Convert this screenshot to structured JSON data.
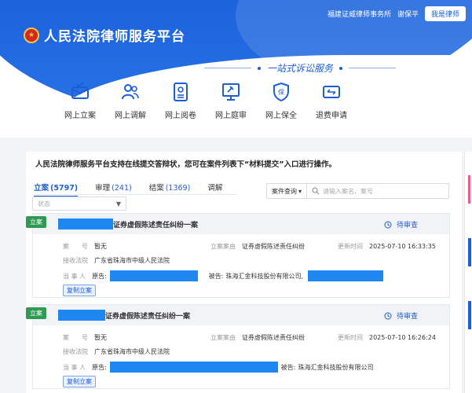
{
  "header": {
    "firm": "福建证威律师事务所",
    "user": "谢保平",
    "login_label": "我是律师",
    "site_title": "人民法院律师服务平台",
    "slogan": "一站式诉讼服务"
  },
  "services": [
    {
      "label": "网上立案",
      "icon": "mail-check-icon"
    },
    {
      "label": "网上调解",
      "icon": "users-icon"
    },
    {
      "label": "网上阅卷",
      "icon": "document-view-icon"
    },
    {
      "label": "网上庭审",
      "icon": "courtroom-icon"
    },
    {
      "label": "网上保全",
      "icon": "shield-icon"
    },
    {
      "label": "退费申请",
      "icon": "refund-icon"
    }
  ],
  "notice": "人民法院律师服务平台支持在线提交答辩状，您可在案件列表下“材料提交”入口进行操作。",
  "tabs": [
    {
      "label": "立案",
      "count": "(5797)",
      "active": true
    },
    {
      "label": "审理",
      "count": "(241)",
      "active": false
    },
    {
      "label": "结案",
      "count": "(1369)",
      "active": false
    },
    {
      "label": "调解",
      "count": "",
      "active": false
    }
  ],
  "filters": {
    "status_placeholder": "状态",
    "query_type": "案件查询",
    "search_placeholder": "请输入案名、案号"
  },
  "cases": [
    {
      "tag": "立案",
      "title_suffix": "证券虚假陈述责任纠纷一案",
      "status": "待审查",
      "case_no_label": "案　　号",
      "case_no": "暂无",
      "cause_label": "立案案由",
      "cause": "证券虚假陈述责任纠纷",
      "updated_label": "更新时间",
      "updated": "2025-07-10 16:33:35",
      "court_label": "接收法院",
      "court": "广东省珠海市中级人民法院",
      "party_label": "当 事 人",
      "plaintiff_label": "原告:",
      "defendant_label": "被告:",
      "defendant": "珠海汇金科技股份有限公司,",
      "copy_label": "复制立案"
    },
    {
      "tag": "立案",
      "title_suffix": "证券虚假陈述责任纠纷一案",
      "status": "待审查",
      "case_no_label": "案　　号",
      "case_no": "暂无",
      "cause_label": "立案案由",
      "cause": "证券虚假陈述责任纠纷",
      "updated_label": "更新时间",
      "updated": "2025-07-10 16:26:24",
      "court_label": "接收法院",
      "court": "广东省珠海市中级人民法院",
      "party_label": "当 事 人",
      "plaintiff_label": "原告:",
      "defendant_label": "被告:",
      "defendant": "珠海汇金科技股份有限公司",
      "copy_label": "复制立案"
    }
  ],
  "colors": {
    "brand": "#1b5ed6",
    "tag": "#2e9a52",
    "redaction": "#1e88f0"
  }
}
